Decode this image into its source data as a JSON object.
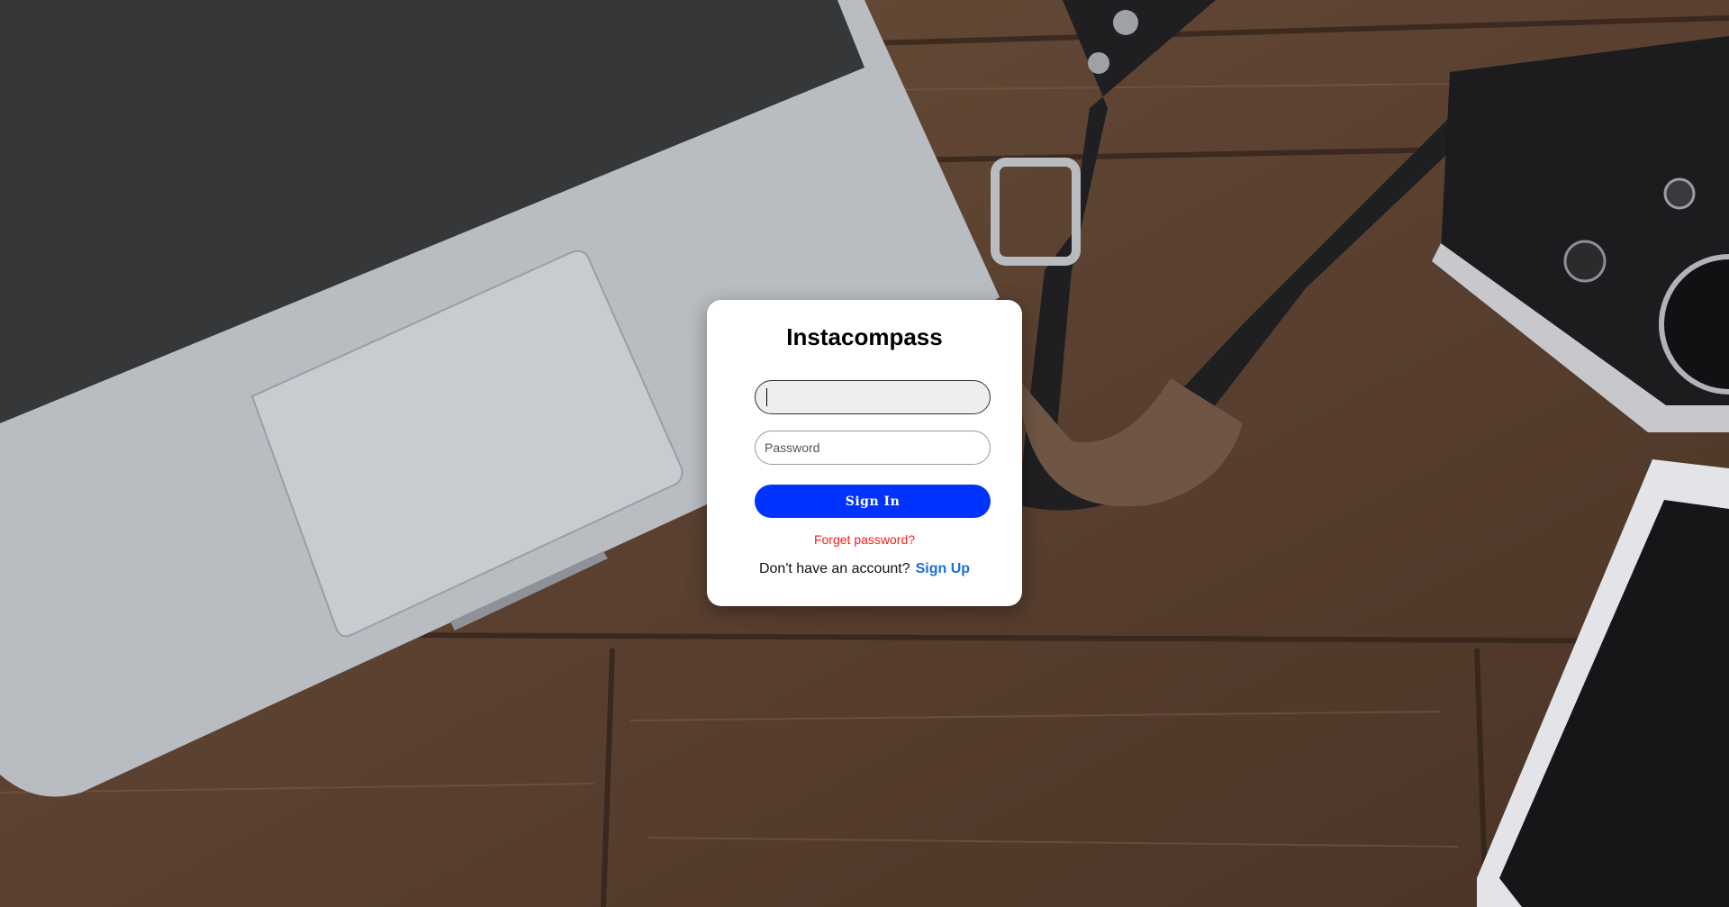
{
  "app": {
    "title": "Instacompass"
  },
  "login": {
    "username_value": "",
    "password_placeholder": "Password",
    "signin_label": "Sign In",
    "forgot_label": "Forget password?",
    "no_account_text": "Don't have an account?",
    "signup_label": "Sign Up"
  },
  "colors": {
    "signin_button": "#0033ff",
    "forgot_link": "#ff1a1a",
    "signup_link": "#1a6fe0"
  }
}
